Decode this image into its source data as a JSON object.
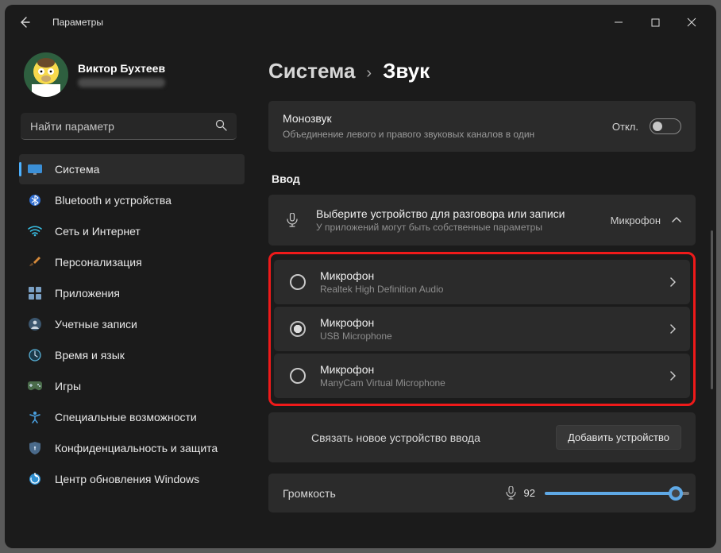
{
  "titlebar": {
    "title": "Параметры"
  },
  "account": {
    "name": "Виктор Бухтеев"
  },
  "search": {
    "placeholder": "Найти параметр"
  },
  "sidebar": {
    "items": [
      {
        "label": "Система"
      },
      {
        "label": "Bluetooth и устройства"
      },
      {
        "label": "Сеть и Интернет"
      },
      {
        "label": "Персонализация"
      },
      {
        "label": "Приложения"
      },
      {
        "label": "Учетные записи"
      },
      {
        "label": "Время и язык"
      },
      {
        "label": "Игры"
      },
      {
        "label": "Специальные возможности"
      },
      {
        "label": "Конфиденциальность и защита"
      },
      {
        "label": "Центр обновления Windows"
      }
    ]
  },
  "breadcrumb": {
    "parent": "Система",
    "sep": "›",
    "current": "Звук"
  },
  "mono": {
    "title": "Монозвук",
    "sub": "Объединение левого и правого звуковых каналов в один",
    "state": "Откл."
  },
  "input": {
    "heading": "Ввод",
    "choose_title": "Выберите устройство для разговора или записи",
    "choose_sub": "У приложений могут быть собственные параметры",
    "current_device": "Микрофон",
    "devices": [
      {
        "title": "Микрофон",
        "sub": "Realtek High Definition Audio",
        "selected": false
      },
      {
        "title": "Микрофон",
        "sub": "USB Microphone",
        "selected": true
      },
      {
        "title": "Микрофон",
        "sub": "ManyCam Virtual Microphone",
        "selected": false
      }
    ],
    "pair_label": "Связать новое устройство ввода",
    "pair_button": "Добавить устройство"
  },
  "volume": {
    "label": "Громкость",
    "value": "92"
  }
}
